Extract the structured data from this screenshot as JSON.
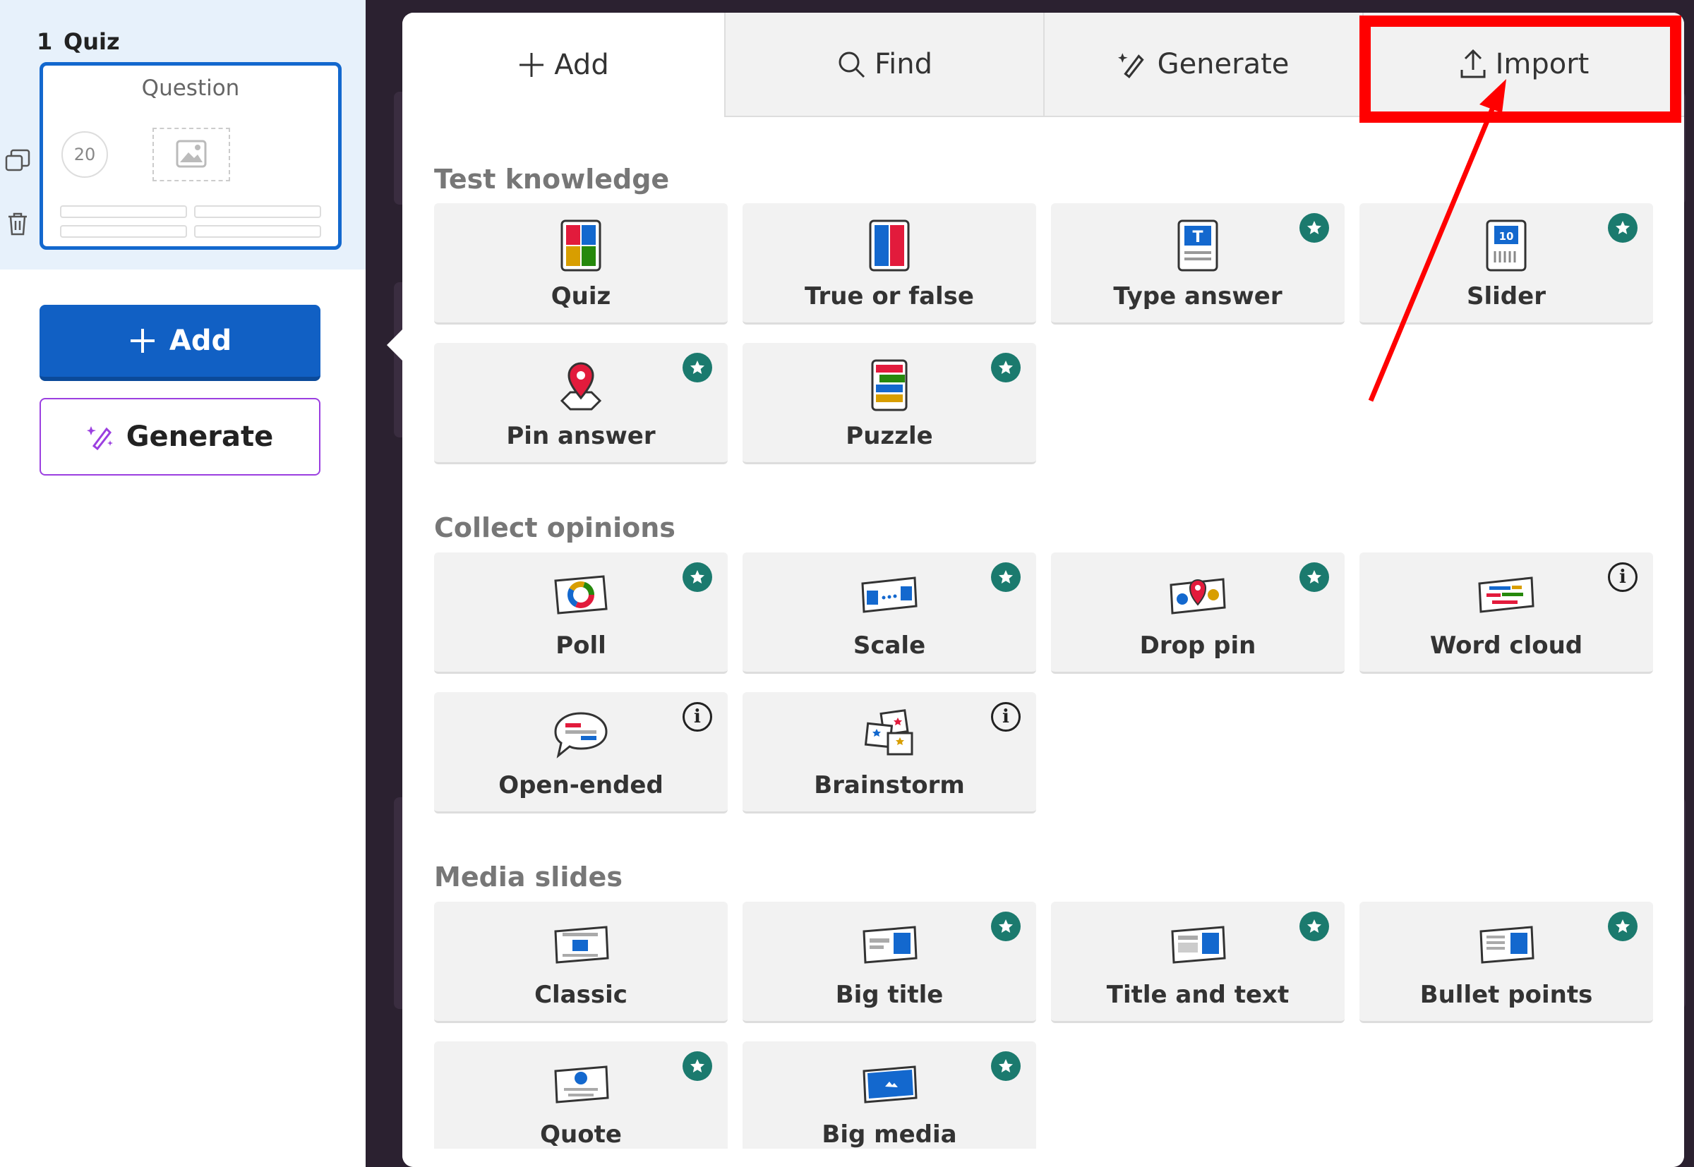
{
  "sidebar": {
    "slide_number": "1",
    "slide_type": "Quiz",
    "thumbnail": {
      "title": "Question",
      "timer": "20"
    },
    "add_label": "Add",
    "generate_label": "Generate"
  },
  "panel": {
    "tabs": [
      {
        "label": "Add",
        "icon": "plus-icon",
        "active": true
      },
      {
        "label": "Find",
        "icon": "search-icon",
        "active": false
      },
      {
        "label": "Generate",
        "icon": "magic-wand-icon",
        "active": false
      },
      {
        "label": "Import",
        "icon": "upload-icon",
        "active": false
      }
    ],
    "sections": [
      {
        "title": "Test knowledge",
        "items": [
          {
            "label": "Quiz",
            "badge": "none"
          },
          {
            "label": "True or false",
            "badge": "none"
          },
          {
            "label": "Type answer",
            "badge": "star"
          },
          {
            "label": "Slider",
            "badge": "star"
          },
          {
            "label": "Pin answer",
            "badge": "star"
          },
          {
            "label": "Puzzle",
            "badge": "star"
          }
        ]
      },
      {
        "title": "Collect opinions",
        "items": [
          {
            "label": "Poll",
            "badge": "star"
          },
          {
            "label": "Scale",
            "badge": "star"
          },
          {
            "label": "Drop pin",
            "badge": "star"
          },
          {
            "label": "Word cloud",
            "badge": "info"
          },
          {
            "label": "Open-ended",
            "badge": "info"
          },
          {
            "label": "Brainstorm",
            "badge": "info"
          }
        ]
      },
      {
        "title": "Media slides",
        "items": [
          {
            "label": "Classic",
            "badge": "none"
          },
          {
            "label": "Big title",
            "badge": "star"
          },
          {
            "label": "Title and text",
            "badge": "star"
          },
          {
            "label": "Bullet points",
            "badge": "star"
          },
          {
            "label": "Quote",
            "badge": "star"
          },
          {
            "label": "Big media",
            "badge": "star"
          }
        ]
      }
    ],
    "info_glyph": "i"
  },
  "colors": {
    "primary_blue": "#1160c4",
    "premium_badge": "#1b7a6e",
    "highlight_red": "#ff0000",
    "generate_purple": "#9b3fe0"
  }
}
